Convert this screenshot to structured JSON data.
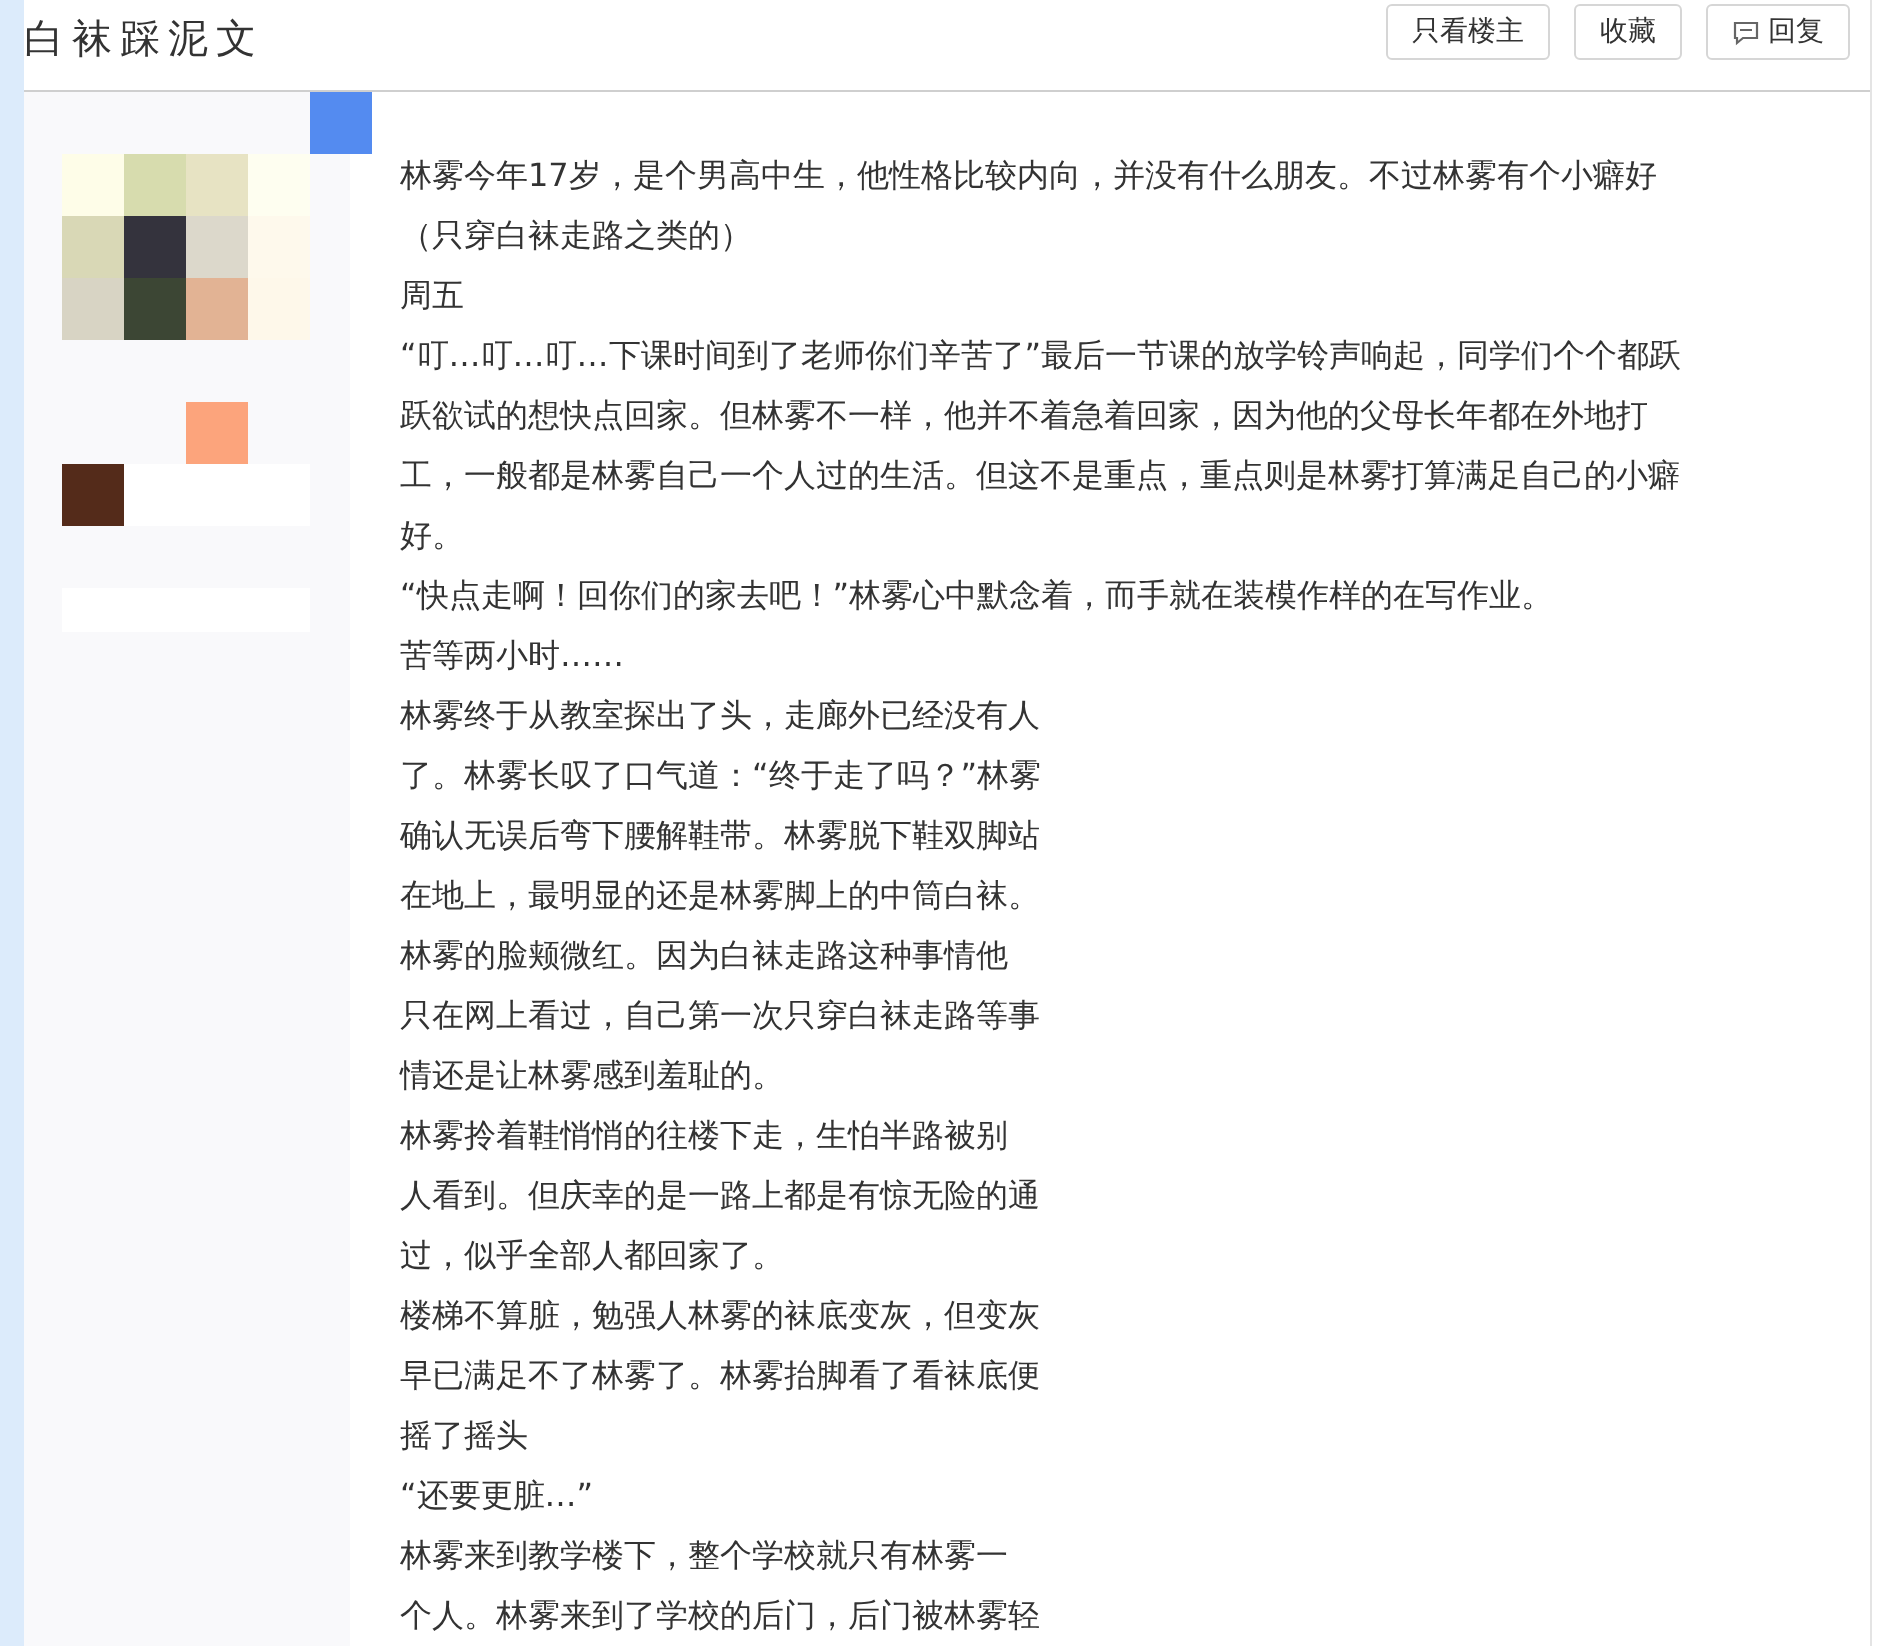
{
  "header": {
    "title": "白袜踩泥文",
    "buttons": [
      {
        "label": "只看楼主",
        "kind": "plain"
      },
      {
        "label": "收藏",
        "kind": "plain"
      },
      {
        "label": "回复",
        "kind": "reply"
      }
    ]
  },
  "post": {
    "lines": [
      "林雾今年17岁，是个男高中生，他性格比较内向，并没有什么朋友。不过林雾有个小癖好",
      "（只穿白袜走路之类的）",
      "周五",
      "“叮…叮…叮…下课时间到了老师你们辛苦了”最后一节课的放学铃声响起，同学们个个都跃",
      "跃欲试的想快点回家。但林雾不一样，他并不着急着回家，因为他的父母长年都在外地打",
      "工，一般都是林雾自己一个人过的生活。但这不是重点，重点则是林雾打算满足自己的小癖",
      "好。",
      "“快点走啊！回你们的家去吧！”林雾心中默念着，而手就在装模作样的在写作业。",
      "苦等两小时……",
      "林雾终于从教室探出了头，走廊外已经没有人",
      "了。林雾长叹了口气道：“终于走了吗？”林雾",
      "确认无误后弯下腰解鞋带。林雾脱下鞋双脚站",
      "在地上，最明显的还是林雾脚上的中筒白袜。",
      "林雾的脸颊微红。因为白袜走路这种事情他",
      "只在网上看过，自己第一次只穿白袜走路等事",
      "情还是让林雾感到羞耻的。",
      "林雾拎着鞋悄悄的往楼下走，生怕半路被别",
      "人看到。但庆幸的是一路上都是有惊无险的通",
      "过，似乎全部人都回家了。",
      "楼梯不算脏，勉强人林雾的袜底变灰，但变灰",
      "早已满足不了林雾了。林雾抬脚看了看袜底便",
      "摇了摇头",
      "“还要更脏…”",
      "林雾来到教学楼下，整个学校就只有林雾一",
      "个人。林雾来到了学校的后门，后门被林雾轻"
    ]
  }
}
